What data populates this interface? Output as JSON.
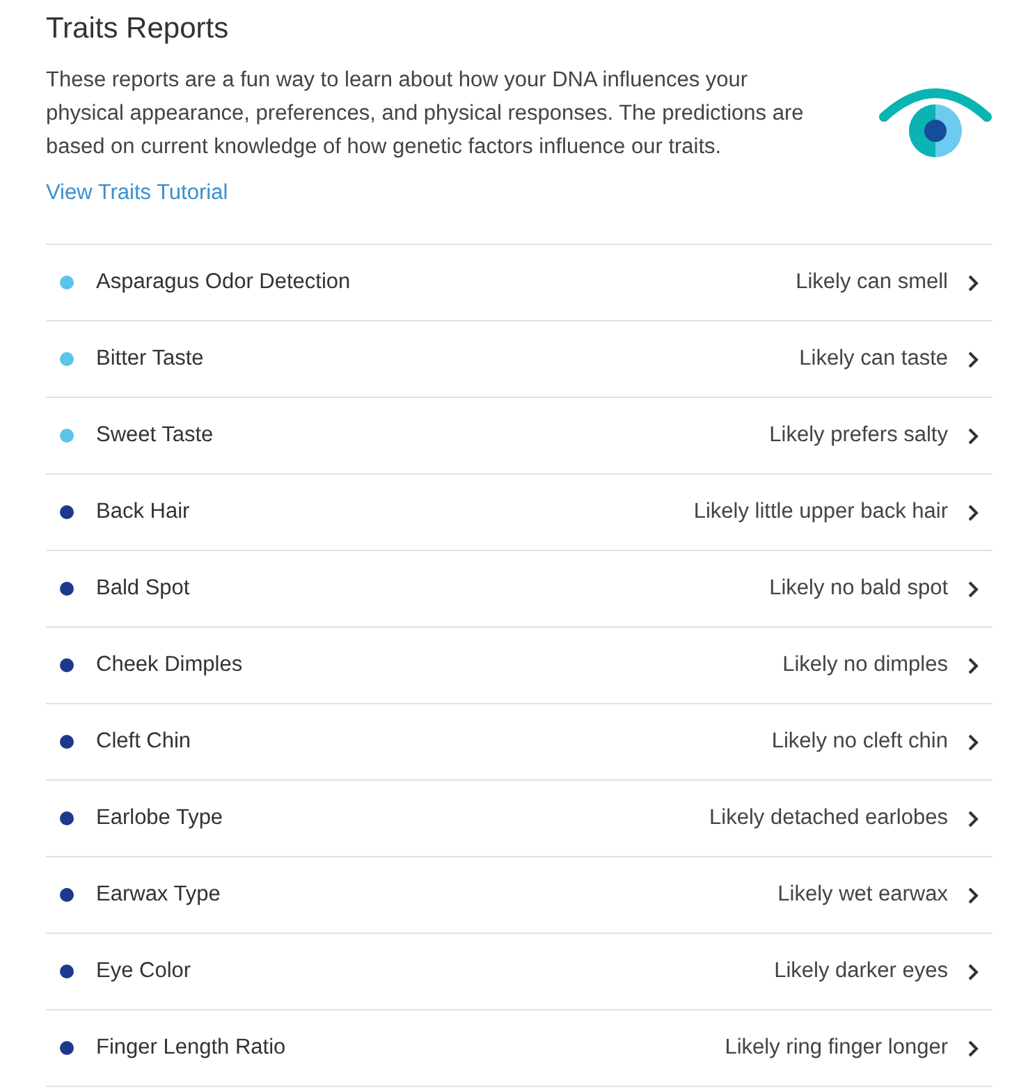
{
  "title": "Traits Reports",
  "intro": "These reports are a fun way to learn about how your DNA influences your physical appearance, preferences, and physical responses. The predictions are based on current knowledge of how genetic factors influence our traits.",
  "tutorial_link": "View Traits Tutorial",
  "traits": [
    {
      "name": "Asparagus Odor Detection",
      "result": "Likely can smell",
      "color": "#5bc4ec"
    },
    {
      "name": "Bitter Taste",
      "result": "Likely can taste",
      "color": "#5bc4ec"
    },
    {
      "name": "Sweet Taste",
      "result": "Likely prefers salty",
      "color": "#5bc4ec"
    },
    {
      "name": "Back Hair",
      "result": "Likely little upper back hair",
      "color": "#1c3a8c"
    },
    {
      "name": "Bald Spot",
      "result": "Likely no bald spot",
      "color": "#1c3a8c"
    },
    {
      "name": "Cheek Dimples",
      "result": "Likely no dimples",
      "color": "#1c3a8c"
    },
    {
      "name": "Cleft Chin",
      "result": "Likely no cleft chin",
      "color": "#1c3a8c"
    },
    {
      "name": "Earlobe Type",
      "result": "Likely detached earlobes",
      "color": "#1c3a8c"
    },
    {
      "name": "Earwax Type",
      "result": "Likely wet earwax",
      "color": "#1c3a8c"
    },
    {
      "name": "Eye Color",
      "result": "Likely darker eyes",
      "color": "#1c3a8c"
    },
    {
      "name": "Finger Length Ratio",
      "result": "Likely ring finger longer",
      "color": "#1c3a8c"
    }
  ]
}
